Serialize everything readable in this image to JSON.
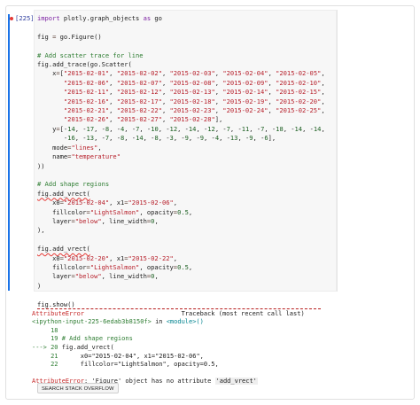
{
  "cell": {
    "prompt": "[225]",
    "lines": [
      "import plotly.graph_objects as go",
      "",
      "fig = go.Figure()",
      "",
      "# Add scatter trace for line",
      "fig.add_trace(go.Scatter(",
      "    x=[\"2015-02-01\", \"2015-02-02\", \"2015-02-03\", \"2015-02-04\", \"2015-02-05\",",
      "       \"2015-02-06\", \"2015-02-07\", \"2015-02-08\", \"2015-02-09\", \"2015-02-10\",",
      "       \"2015-02-11\", \"2015-02-12\", \"2015-02-13\", \"2015-02-14\", \"2015-02-15\",",
      "       \"2015-02-16\", \"2015-02-17\", \"2015-02-18\", \"2015-02-19\", \"2015-02-20\",",
      "       \"2015-02-21\", \"2015-02-22\", \"2015-02-23\", \"2015-02-24\", \"2015-02-25\",",
      "       \"2015-02-26\", \"2015-02-27\", \"2015-02-28\"],",
      "    y=[-14, -17, -8, -4, -7, -10, -12, -14, -12, -7, -11, -7, -18, -14, -14,",
      "       -16, -13, -7, -8, -14, -8, -3, -9, -9, -4, -13, -9, -6],",
      "    mode=\"lines\",",
      "    name=\"temperature\"",
      "))",
      "",
      "# Add shape regions",
      "fig.add_vrect(",
      "    x0=\"2015-02-04\", x1=\"2015-02-06\",",
      "    fillcolor=\"LightSalmon\", opacity=0.5,",
      "    layer=\"below\", line_width=0,",
      "),",
      "",
      "fig.add_vrect(",
      "    x0=\"2015-02-20\", x1=\"2015-02-22\",",
      "    fillcolor=\"LightSalmon\", opacity=0.5,",
      "    layer=\"below\", line_width=0,",
      ")",
      "",
      "fig.show()"
    ]
  },
  "error": {
    "header_name": "AttributeError",
    "header_tb": "Traceback (most recent call last)",
    "input_link": "<ipython-input-225-6edab3b8150f>",
    "in_word": " in ",
    "module": "<module>()",
    "line18": "     18",
    "line19_num": "     19 ",
    "line19_code": "# Add shape regions",
    "arrow": "---> ",
    "line20_num": "20 ",
    "line20_code_a": "fig.add_vrect(",
    "line21_num": "     21      ",
    "line21_code": "x0=\"2015-02-04\", x1=\"2015-02-06\",",
    "line22_num": "     22      ",
    "line22_code": "fillcolor=\"LightSalmon\", opacity=0.5,",
    "final_name": "AttributeError",
    "final_msg": ": 'Figure' object has no attribute ",
    "final_attr": "'add_vrect'"
  },
  "buttons": {
    "search_so": "SEARCH STACK OVERFLOW"
  },
  "colors": {
    "run_indicator": "#e53935",
    "cell_active_bar": "#1a73e8",
    "error_red": "#c62828"
  }
}
